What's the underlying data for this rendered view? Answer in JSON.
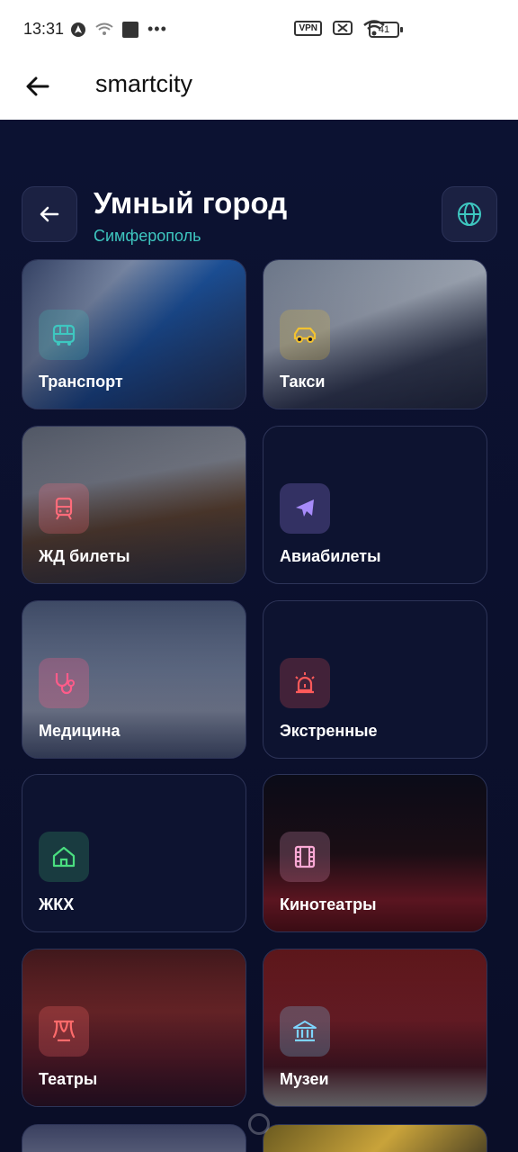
{
  "status_bar": {
    "time": "13:31",
    "vpn": "VPN",
    "battery": "41"
  },
  "app_bar": {
    "title": "smartcity"
  },
  "header": {
    "title": "Умный город",
    "subtitle": "Симферополь"
  },
  "tiles": [
    {
      "label": "Транспорт",
      "icon": "bus-icon",
      "icon_color": "#3ec7c0"
    },
    {
      "label": "Такси",
      "icon": "car-icon",
      "icon_color": "#f2c230"
    },
    {
      "label": "ЖД билеты",
      "icon": "train-icon",
      "icon_color": "#ff6b7a"
    },
    {
      "label": "Авиабилеты",
      "icon": "plane-icon",
      "icon_color": "#a78bfa"
    },
    {
      "label": "Медицина",
      "icon": "stethoscope-icon",
      "icon_color": "#ff5c8a"
    },
    {
      "label": "Экстренные",
      "icon": "siren-icon",
      "icon_color": "#ff5a5a"
    },
    {
      "label": "ЖКХ",
      "icon": "home-icon",
      "icon_color": "#4ade80"
    },
    {
      "label": "Кинотеатры",
      "icon": "film-icon",
      "icon_color": "#f9a8d4"
    },
    {
      "label": "Театры",
      "icon": "theater-icon",
      "icon_color": "#ff6b6b"
    },
    {
      "label": "Музеи",
      "icon": "museum-icon",
      "icon_color": "#7dd3fc"
    }
  ]
}
